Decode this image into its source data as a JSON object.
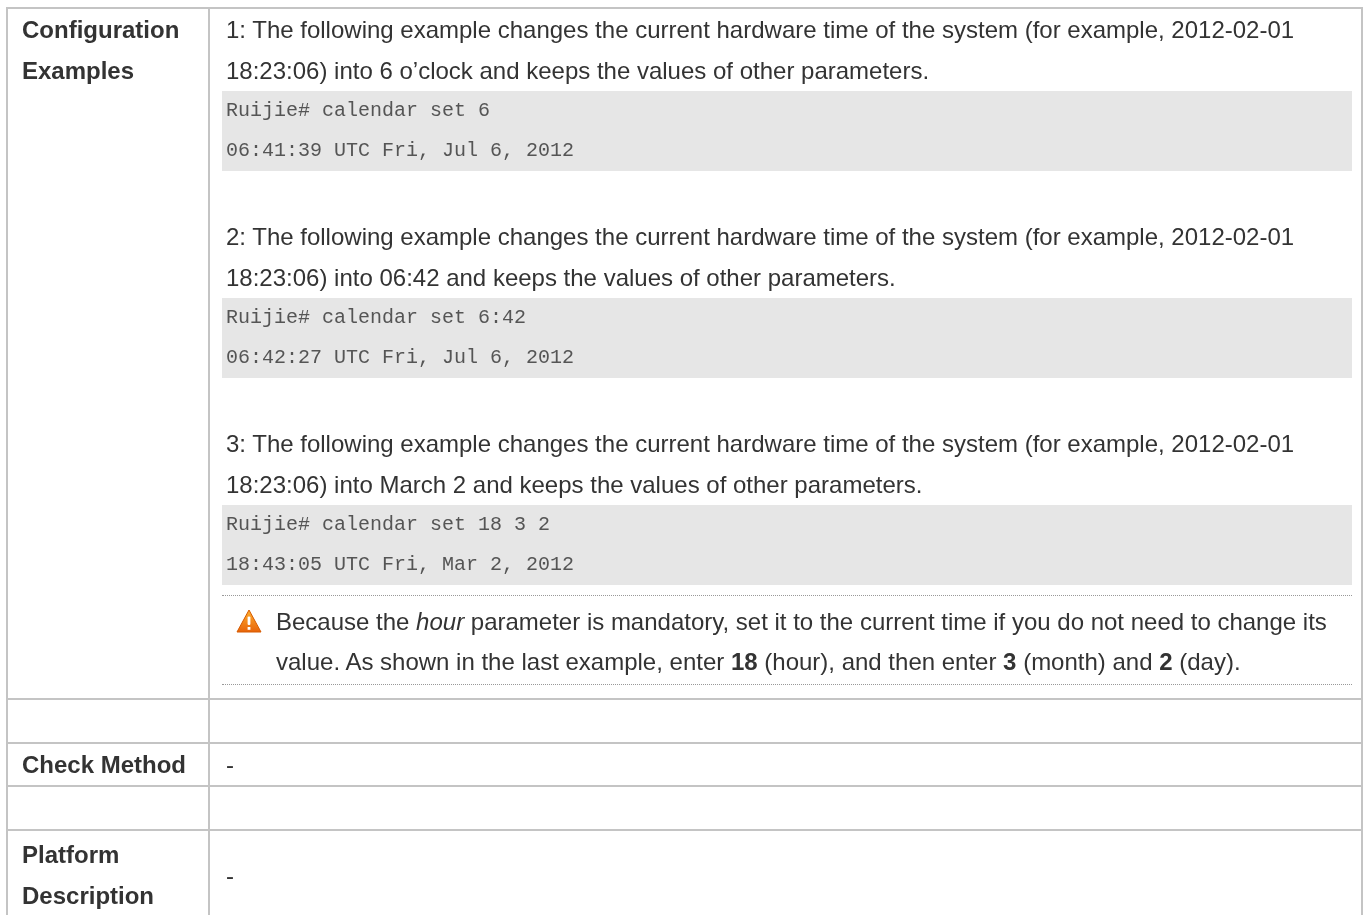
{
  "rows": [
    {
      "kind": "entry",
      "label": "Configuration Examples",
      "content": [
        {
          "kind": "text",
          "text": "1: The following example changes the current hardware time of the system (for example, 2012-02-01 18:23:06) into 6 o’clock and keeps the values of other parameters."
        },
        {
          "kind": "code",
          "lines": [
            "Ruijie# calendar set 6",
            "06:41:39 UTC Fri, Jul 6, 2012"
          ]
        },
        {
          "kind": "gap"
        },
        {
          "kind": "text",
          "text": "2: The following example changes the current hardware time of the system (for example, 2012-02-01 18:23:06) into 06:42 and keeps the values of other parameters."
        },
        {
          "kind": "code",
          "lines": [
            "Ruijie# calendar set 6:42",
            "06:42:27 UTC Fri, Jul 6, 2012"
          ]
        },
        {
          "kind": "gap"
        },
        {
          "kind": "text",
          "text": "3: The following example changes the current hardware time of the system (for example, 2012-02-01 18:23:06) into March 2 and keeps the values of other parameters."
        },
        {
          "kind": "code",
          "lines": [
            "Ruijie# calendar set 18 3 2",
            "18:43:05 UTC Fri, Mar 2, 2012"
          ]
        },
        {
          "kind": "warning",
          "text": "Because the *hour* parameter is mandatory, set it to the current time if you do not need to change its value. As shown in the last example, enter **18** (hour), and then enter **3** (month) and **2** (day)."
        }
      ]
    },
    {
      "kind": "spacer"
    },
    {
      "kind": "entry",
      "label": "Check Method",
      "content": [
        {
          "kind": "text",
          "text": "-"
        }
      ]
    },
    {
      "kind": "spacer"
    },
    {
      "kind": "entry",
      "label": "Platform Description",
      "content": [
        {
          "kind": "text",
          "text": "-"
        }
      ]
    }
  ]
}
